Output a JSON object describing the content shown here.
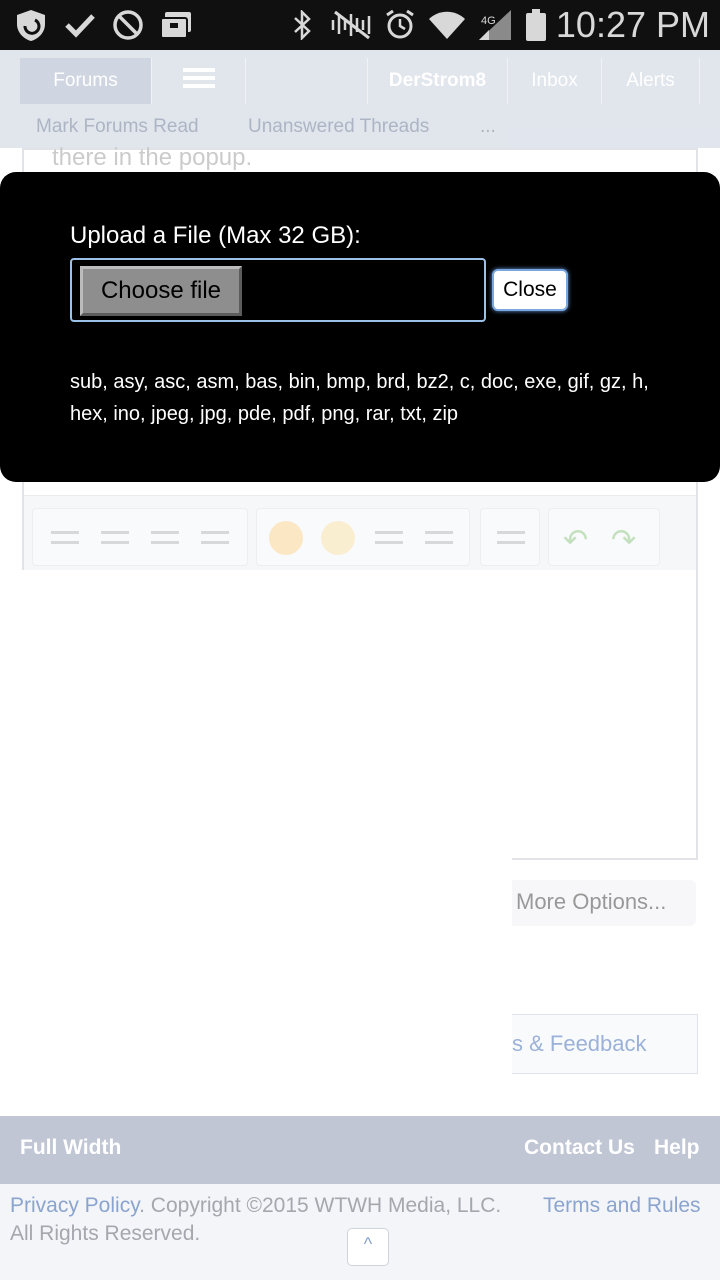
{
  "status_bar": {
    "time": "10:27 PM",
    "icons": [
      "shield-icon",
      "check-icon",
      "no-entry-icon",
      "briefcase-icon",
      "bluetooth-icon",
      "mute-icon",
      "alarm-icon",
      "wifi-icon",
      "signal-icon",
      "battery-icon"
    ]
  },
  "nav": {
    "tabs": [
      {
        "label": "Forums"
      },
      {
        "label": ""
      },
      {
        "label": "DerStrom8"
      },
      {
        "label": "Inbox"
      },
      {
        "label": "Alerts"
      }
    ],
    "sub_links": [
      "Mark Forums Read",
      "Unanswered Threads",
      "..."
    ]
  },
  "background": {
    "popup_text": "there in the popup.",
    "more_options": "More Options...",
    "feedback": "s & Feedback"
  },
  "modal": {
    "title": "Upload a File (Max 32 GB):",
    "choose_file": "Choose file",
    "close": "Close",
    "extensions": "sub, asy, asc, asm, bas, bin, bmp, brd, bz2, c, doc, exe, gif, gz, h, hex, ino, jpeg, jpg, pde, pdf, png, rar, txt, zip"
  },
  "footer": {
    "full_width": "Full Width",
    "contact_us": "Contact Us",
    "help": "Help",
    "privacy_policy": "Privacy Policy",
    "copyright": ". Copyright ©2015 WTWH Media, LLC.",
    "rights": "All Rights Reserved.",
    "terms": "Terms and Rules",
    "to_top": "^"
  }
}
